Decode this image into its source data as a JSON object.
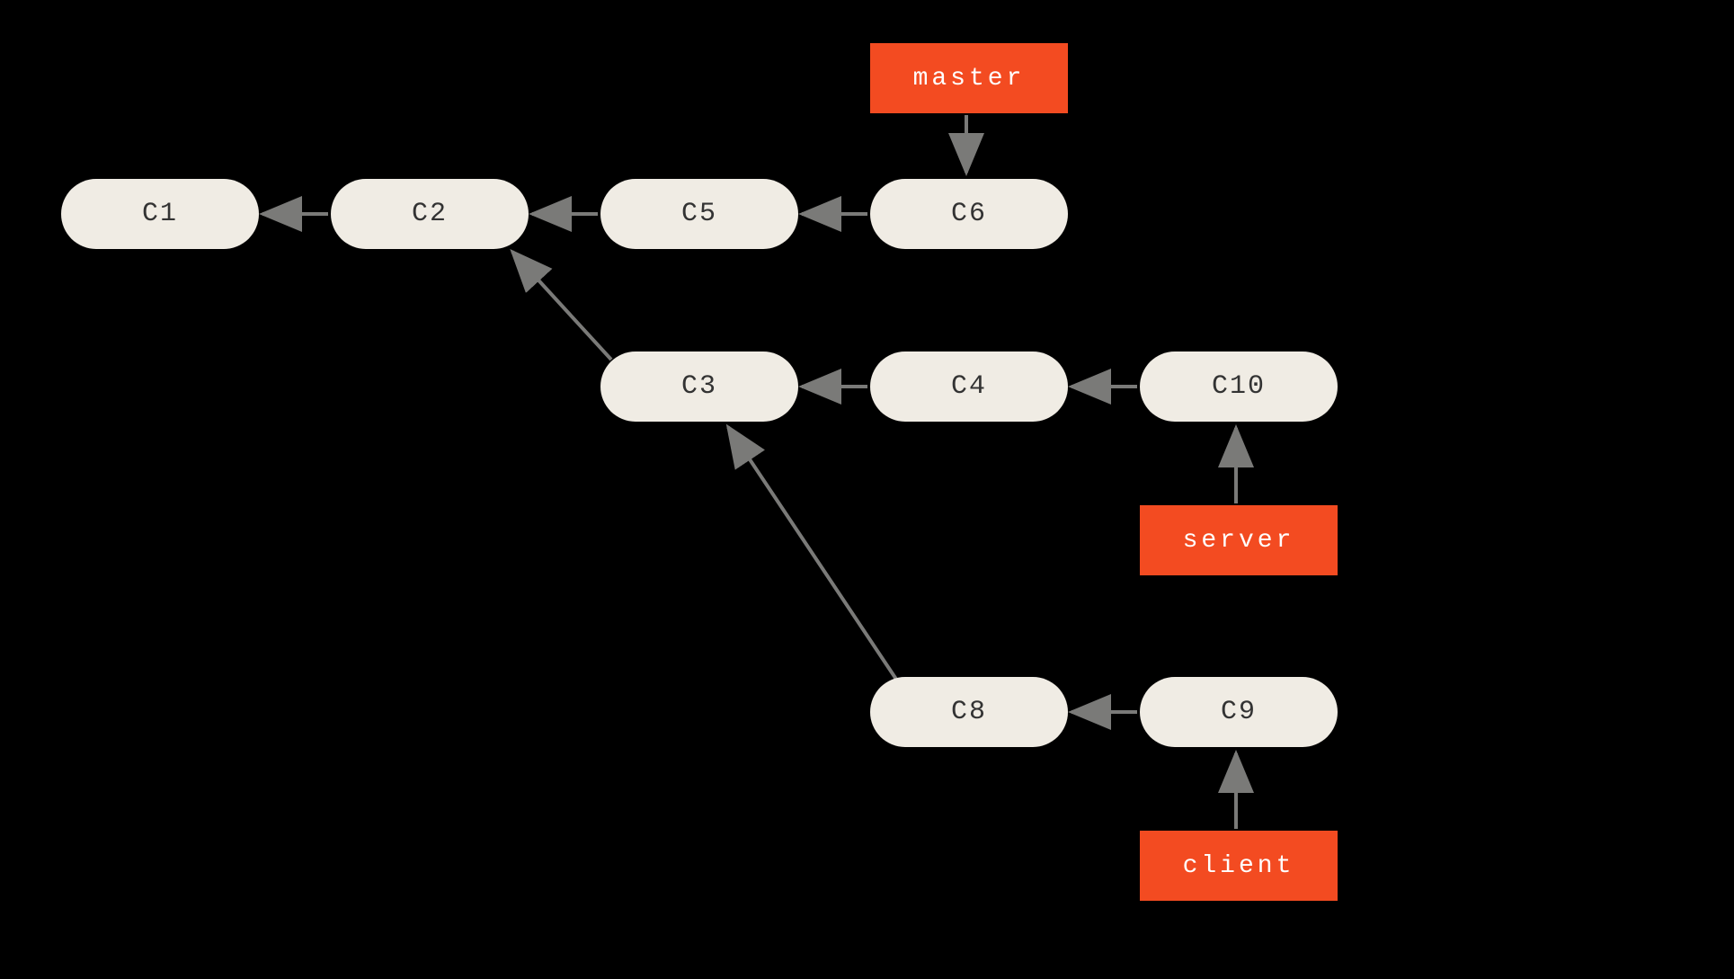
{
  "commits": {
    "c1": "C1",
    "c2": "C2",
    "c3": "C3",
    "c4": "C4",
    "c5": "C5",
    "c6": "C6",
    "c8": "C8",
    "c9": "C9",
    "c10": "C10"
  },
  "branches": {
    "master": "master",
    "server": "server",
    "client": "client"
  },
  "graph": {
    "commit_parents": {
      "C2": [
        "C1"
      ],
      "C5": [
        "C2"
      ],
      "C6": [
        "C5"
      ],
      "C3": [
        "C2"
      ],
      "C4": [
        "C3"
      ],
      "C10": [
        "C4"
      ],
      "C8": [
        "C3"
      ],
      "C9": [
        "C8"
      ]
    },
    "branch_heads": {
      "master": "C6",
      "server": "C10",
      "client": "C9"
    }
  },
  "colors": {
    "commit_bg": "#f0ece4",
    "branch_bg": "#f34b21",
    "arrow": "#7a7a78"
  }
}
